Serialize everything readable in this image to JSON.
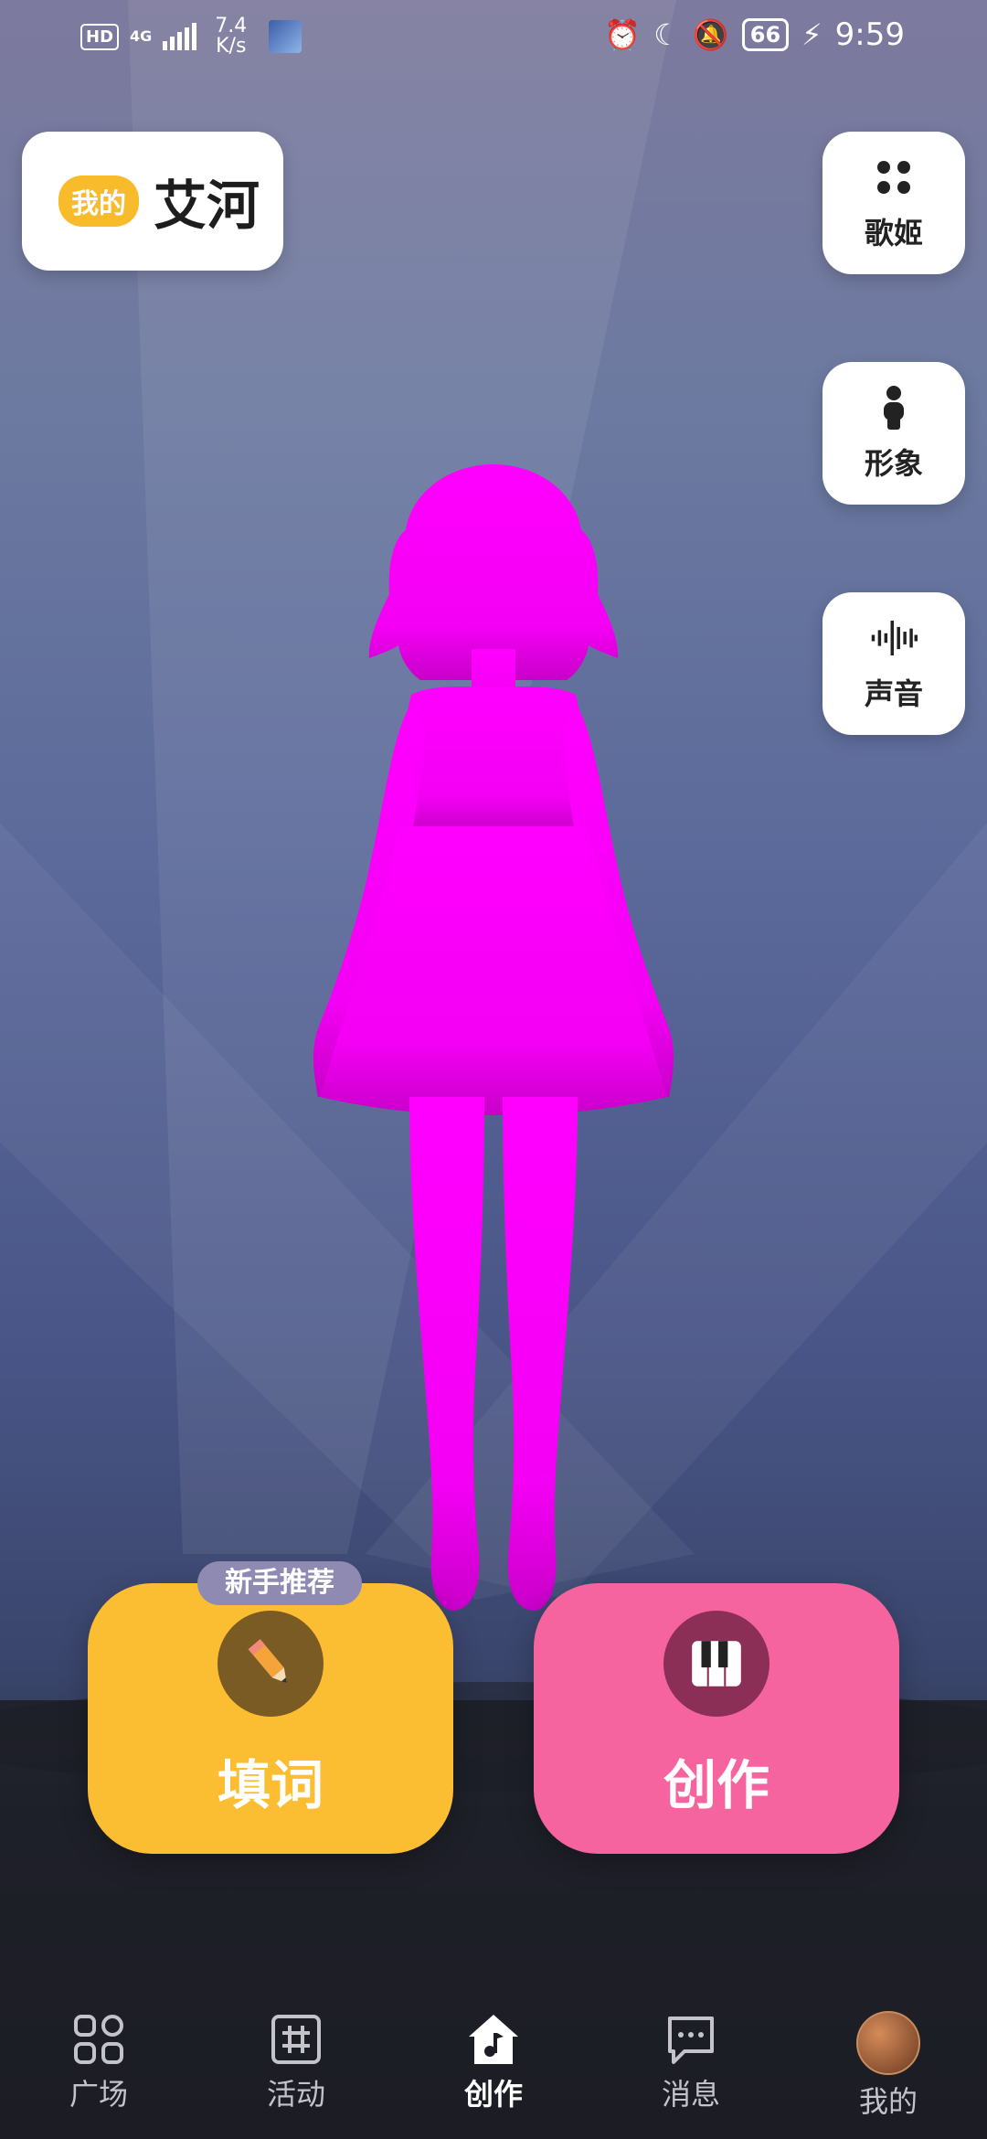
{
  "status_bar": {
    "hd": "HD",
    "network": "4G",
    "speed_value": "7.4",
    "speed_unit": "K/s",
    "battery": "66",
    "time": "9:59"
  },
  "my_card": {
    "tag": "我的",
    "name": "艾河"
  },
  "side_buttons": [
    {
      "label": "歌姬",
      "icon": "dots-grid-icon"
    },
    {
      "label": "形象",
      "icon": "person-icon"
    },
    {
      "label": "声音",
      "icon": "waveform-icon"
    }
  ],
  "badge_new": "新手推荐",
  "actions": {
    "fill_lyrics": {
      "label": "填词",
      "icon": "pencil-icon",
      "color": "#fbbd31"
    },
    "create": {
      "label": "创作",
      "icon": "piano-keys-icon",
      "color": "#f6649f"
    }
  },
  "nav": [
    {
      "label": "广场",
      "icon": "grid-icon"
    },
    {
      "label": "活动",
      "icon": "hash-icon"
    },
    {
      "label": "创作",
      "icon": "home-note-icon",
      "active": true
    },
    {
      "label": "消息",
      "icon": "message-icon"
    },
    {
      "label": "我的",
      "icon": "avatar"
    }
  ],
  "colors": {
    "silhouette": "#ff00ff",
    "accent_yellow": "#fbbd31",
    "accent_pink": "#f6649f"
  }
}
